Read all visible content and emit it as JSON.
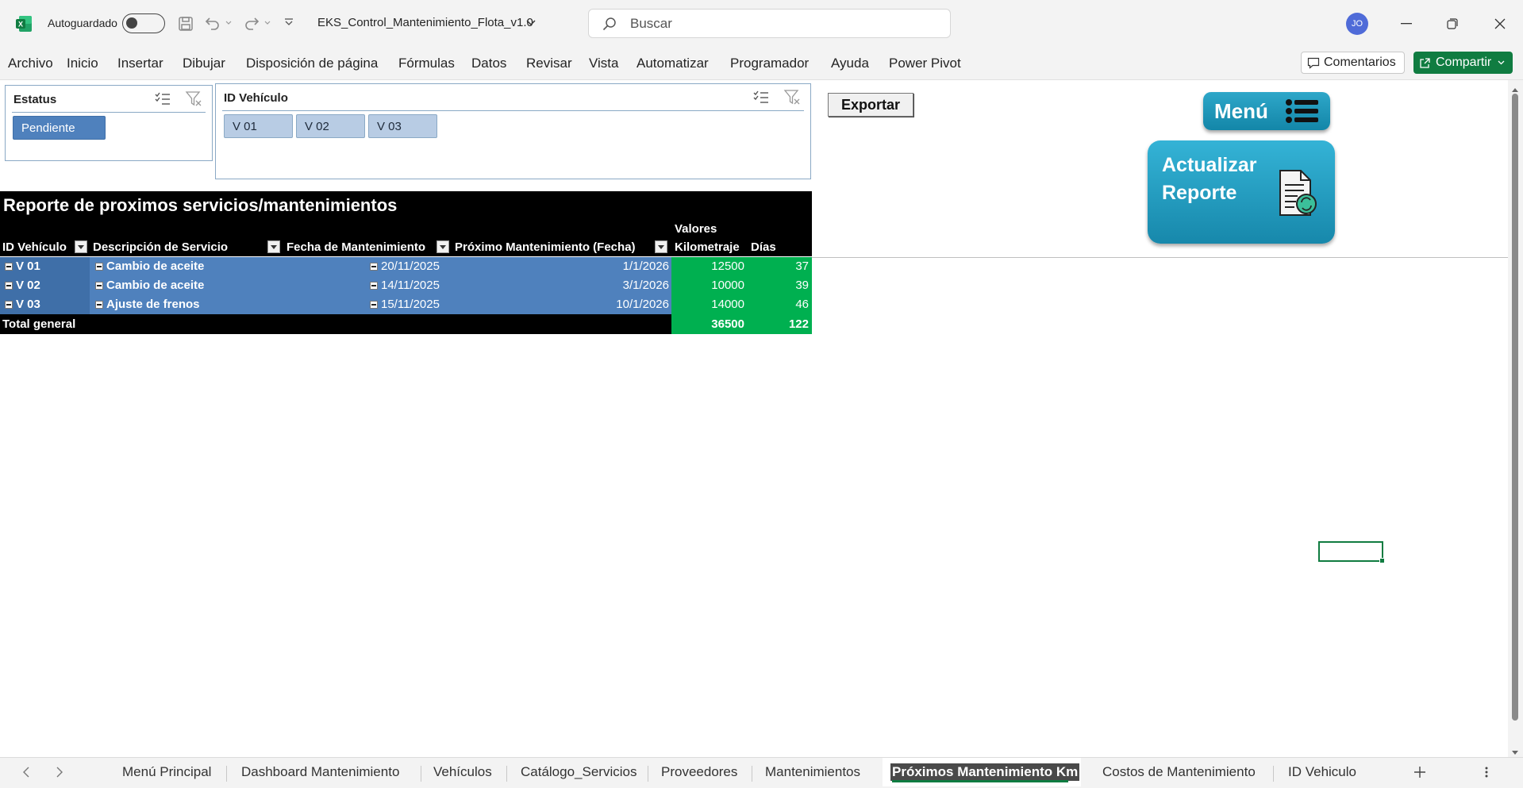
{
  "titlebar": {
    "autosave_label": "Autoguardado",
    "filename": "EKS_Control_Mantenimiento_Flota_v1.0",
    "search_placeholder": "Buscar",
    "avatar_initials": "JO"
  },
  "ribbon": {
    "menu": [
      "Archivo",
      "Inicio",
      "Insertar",
      "Dibujar",
      "Disposición de página",
      "Fórmulas",
      "Datos",
      "Revisar",
      "Vista",
      "Automatizar",
      "Programador",
      "Ayuda",
      "Power Pivot"
    ],
    "comments_label": "Comentarios",
    "share_label": "Compartir"
  },
  "slicers": {
    "status": {
      "title": "Estatus",
      "items": [
        "Pendiente"
      ]
    },
    "vehicle": {
      "title": "ID Vehículo",
      "items": [
        "V 01",
        "V 02",
        "V 03"
      ]
    }
  },
  "buttons": {
    "export": "Exportar",
    "menu": "Menú",
    "refresh_line1": "Actualizar",
    "refresh_line2": "Reporte"
  },
  "pivot": {
    "title": "Reporte de proximos servicios/mantenimientos",
    "values_label": "Valores",
    "headers": [
      "ID Vehículo",
      "Descripción de Servicio",
      "Fecha de Mantenimiento",
      "Próximo Mantenimiento (Fecha)",
      "Kilometraje",
      "Días"
    ],
    "rows": [
      {
        "id": "V 01",
        "service": "Cambio de aceite",
        "date": "20/11/2025",
        "next": "1/1/2026",
        "km": "12500",
        "days": "37"
      },
      {
        "id": "V 02",
        "service": "Cambio de aceite",
        "date": "14/11/2025",
        "next": "3/1/2026",
        "km": "10000",
        "days": "39"
      },
      {
        "id": "V 03",
        "service": "Ajuste de frenos",
        "date": "15/11/2025",
        "next": "10/1/2026",
        "km": "14000",
        "days": "46"
      }
    ],
    "total_label": "Total general",
    "total_km": "36500",
    "total_days": "122"
  },
  "sheet_tabs": [
    "Menú Principal",
    "Dashboard Mantenimiento",
    "Vehículos",
    "Catálogo_Servicios",
    "Proveedores",
    "Mantenimientos",
    "Próximos Mantenimiento Km",
    "Costos de Mantenimiento",
    "ID Vehiculo"
  ],
  "active_tab": "Próximos Mantenimiento Km",
  "colors": {
    "excel_green": "#107c41",
    "pivot_blue": "#4f81bd",
    "pivot_green": "#00b050",
    "button_teal": "#1e9cc0"
  }
}
